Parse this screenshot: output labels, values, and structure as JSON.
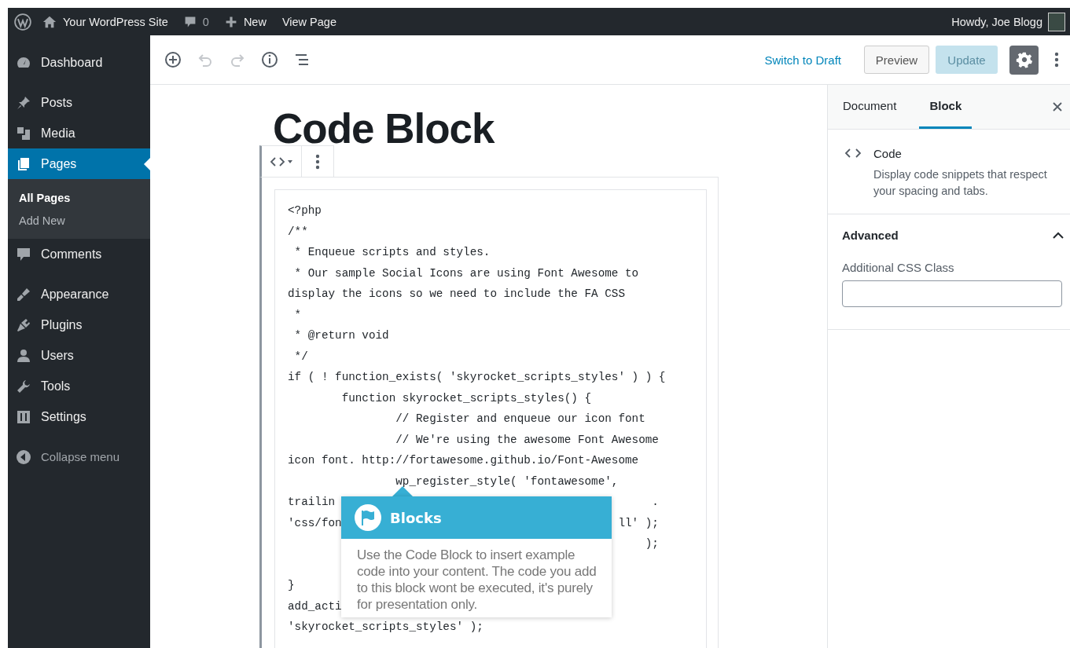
{
  "admin_bar": {
    "site_name": "Your WordPress Site",
    "comments_count": "0",
    "new_label": "New",
    "view_label": "View Page",
    "greeting": "Howdy, Joe Blogg"
  },
  "sidebar": {
    "groups": [
      {
        "items": [
          {
            "label": "Dashboard",
            "selected": false
          }
        ]
      },
      {
        "items": [
          {
            "label": "Posts",
            "selected": false
          },
          {
            "label": "Media",
            "selected": false
          },
          {
            "label": "Pages",
            "selected": true,
            "children": [
              {
                "label": "All Pages",
                "selected": true
              },
              {
                "label": "Add New",
                "selected": false
              }
            ]
          },
          {
            "label": "Comments",
            "selected": false
          }
        ]
      },
      {
        "items": [
          {
            "label": "Appearance",
            "selected": false
          },
          {
            "label": "Plugins",
            "selected": false
          },
          {
            "label": "Users",
            "selected": false
          },
          {
            "label": "Tools",
            "selected": false
          },
          {
            "label": "Settings",
            "selected": false
          }
        ]
      }
    ],
    "collapse_label": "Collapse menu"
  },
  "editor_header": {
    "switch_label": "Switch to Draft",
    "preview_label": "Preview",
    "update_label": "Update",
    "update_disabled": true,
    "settings_open": true
  },
  "post": {
    "title": "Code Block"
  },
  "code_lines": [
    {
      "text": "<?php"
    },
    {
      "text": "/**"
    },
    {
      "text": " * Enqueue scripts and styles."
    },
    {
      "text": " * Our sample Social Icons are using Font Awesome to"
    },
    {
      "text": "display the icons so we need to include the FA CSS"
    },
    {
      "text": " *"
    },
    {
      "text": " * @return void"
    },
    {
      "text": " */"
    },
    {
      "text": "if ( ! function_exists( 'skyrocket_scripts_styles' ) ) {"
    },
    {
      "text": "        function skyrocket_scripts_styles() {"
    },
    {
      "text": "                // Register and enqueue our icon font"
    },
    {
      "text": "                // We're using the awesome Font Awesome"
    },
    {
      "text": "icon font. http://fortawesome.github.io/Font-Awesome"
    },
    {
      "text": "                wp_register_style( 'fontawesome',"
    },
    {
      "text": "trailin",
      "right": "."
    },
    {
      "text": "'css/fon",
      "right": "ll' );"
    },
    {
      "right": ");"
    },
    {
      "text": "}",
      "space_before": true
    },
    {
      "text": "add_acti"
    },
    {
      "text": "'skyrocket_scripts_styles' );"
    }
  ],
  "tooltip": {
    "title": "Blocks",
    "text": "Use the Code Block to insert example code into your content. The code you add to this block wont be executed, it's purely for presentation only."
  },
  "settings_panel": {
    "tabs": [
      {
        "label": "Document",
        "selected": false
      },
      {
        "label": "Block",
        "selected": true
      }
    ],
    "block_name": "Code",
    "block_description": "Display code snippets that respect your spacing and tabs.",
    "section": {
      "title": "Advanced",
      "expanded": true,
      "field_label": "Additional CSS Class"
    }
  }
}
